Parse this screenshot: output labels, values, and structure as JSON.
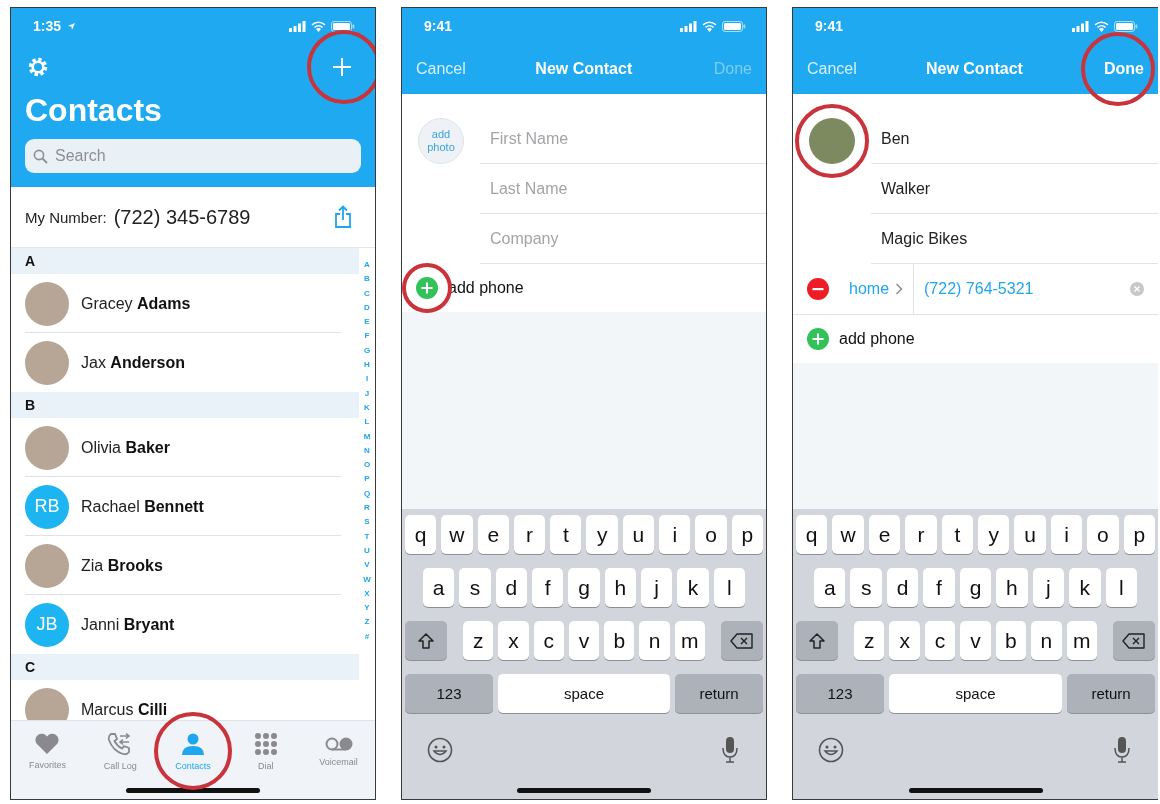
{
  "contacts_screen": {
    "time": "1:35",
    "add_button": {
      "highlighted": true
    },
    "title": "Contacts",
    "search": {
      "placeholder": "Search"
    },
    "my_number": {
      "label": "My Number:",
      "value": "(722) 345-6789"
    },
    "sections": [
      {
        "letter": "A",
        "contacts": [
          {
            "first_name": "Gracey",
            "last_name": "Adams",
            "avatar": {
              "kind": "photo"
            }
          },
          {
            "first_name": "Jax",
            "last_name": "Anderson",
            "avatar": {
              "kind": "photo"
            }
          }
        ]
      },
      {
        "letter": "B",
        "contacts": [
          {
            "first_name": "Olivia",
            "last_name": "Baker",
            "avatar": {
              "kind": "photo"
            }
          },
          {
            "first_name": "Rachael",
            "last_name": "Bennett",
            "avatar": {
              "kind": "initials",
              "initials": "RB"
            }
          },
          {
            "first_name": "Zia",
            "last_name": "Brooks",
            "avatar": {
              "kind": "photo"
            }
          },
          {
            "first_name": "Janni",
            "last_name": "Bryant",
            "avatar": {
              "kind": "initials",
              "initials": "JB"
            }
          }
        ]
      },
      {
        "letter": "C",
        "contacts": [
          {
            "first_name": "Marcus",
            "last_name": "Cilli",
            "avatar": {
              "kind": "photo"
            }
          }
        ]
      }
    ],
    "index": [
      "A",
      "B",
      "C",
      "D",
      "E",
      "F",
      "G",
      "H",
      "I",
      "J",
      "K",
      "L",
      "M",
      "N",
      "O",
      "P",
      "Q",
      "R",
      "S",
      "T",
      "U",
      "V",
      "W",
      "X",
      "Y",
      "Z",
      "#"
    ],
    "tabs": [
      {
        "label": "Favorites",
        "kind": "heart",
        "selected": false,
        "highlighted": false
      },
      {
        "label": "Call Log",
        "kind": "calls",
        "selected": false,
        "highlighted": false
      },
      {
        "label": "Contacts",
        "kind": "person",
        "selected": true,
        "highlighted": true
      },
      {
        "label": "Dial",
        "kind": "dialpad",
        "selected": false,
        "highlighted": false
      },
      {
        "label": "Voicemail",
        "kind": "voicemail",
        "selected": false,
        "highlighted": false
      }
    ]
  },
  "new_contact_screens": [
    {
      "time": "9:41",
      "cancel": "Cancel",
      "title": "New Contact",
      "done": {
        "label": "Done",
        "enabled": false,
        "highlighted": false
      },
      "photo": {
        "kind": "add",
        "label": "add photo",
        "highlighted": false
      },
      "fields": [
        {
          "placeholder": "First Name"
        },
        {
          "placeholder": "Last Name"
        },
        {
          "placeholder": "Company"
        }
      ],
      "add_phone": {
        "label": "add phone",
        "highlighted": true
      },
      "keyboard": {
        "rows": [
          [
            "q",
            "w",
            "e",
            "r",
            "t",
            "y",
            "u",
            "i",
            "o",
            "p"
          ],
          [
            "a",
            "s",
            "d",
            "f",
            "g",
            "h",
            "j",
            "k",
            "l"
          ],
          [
            "z",
            "x",
            "c",
            "v",
            "b",
            "n",
            "m"
          ]
        ],
        "numbers": "123",
        "space": "space",
        "return": "return"
      }
    },
    {
      "time": "9:41",
      "cancel": "Cancel",
      "title": "New Contact",
      "done": {
        "label": "Done",
        "enabled": true,
        "highlighted": true
      },
      "photo": {
        "kind": "photo",
        "highlighted": true
      },
      "fields": [
        {
          "value": "Ben"
        },
        {
          "value": "Walker"
        },
        {
          "value": "Magic Bikes"
        }
      ],
      "phones": [
        {
          "label": "home",
          "number": "(722) 764-5321"
        }
      ],
      "add_phone": {
        "label": "add phone",
        "highlighted": false
      },
      "keyboard": {
        "rows": [
          [
            "q",
            "w",
            "e",
            "r",
            "t",
            "y",
            "u",
            "i",
            "o",
            "p"
          ],
          [
            "a",
            "s",
            "d",
            "f",
            "g",
            "h",
            "j",
            "k",
            "l"
          ],
          [
            "z",
            "x",
            "c",
            "v",
            "b",
            "n",
            "m"
          ]
        ],
        "numbers": "123",
        "space": "space",
        "return": "return"
      }
    }
  ]
}
